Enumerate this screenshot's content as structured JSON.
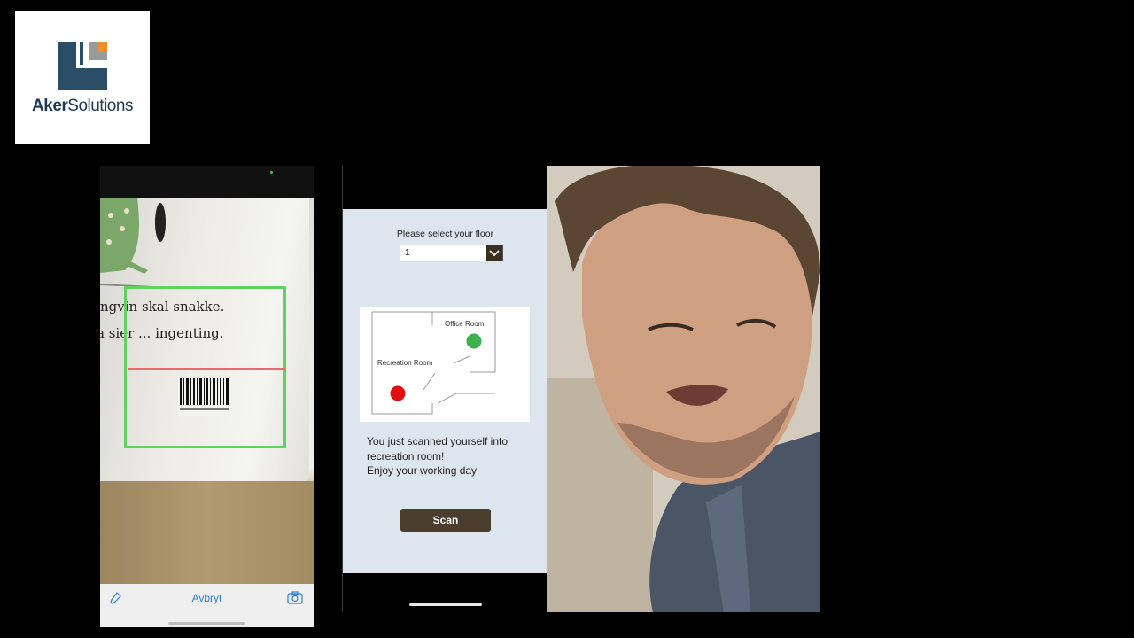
{
  "brand": {
    "name_bold": "Aker",
    "name_rest": "Solutions",
    "colors": {
      "navy": "#2a4e66",
      "orange": "#f28c28",
      "gray": "#9a9a9a"
    }
  },
  "scanner": {
    "book_line_1": "ngvin skal snakke.",
    "book_line_2": "a sier ... ingenting.",
    "cancel_label": "Avbryt",
    "frame_color": "#5fd25f",
    "laser_color": "#e86a6a",
    "icons": [
      "flashlight-icon",
      "camera-icon"
    ]
  },
  "floor_app": {
    "select_prompt": "Please select your floor",
    "floor_value": "1",
    "map": {
      "office_label": "Office Room",
      "recreation_label": "Recreation Room",
      "office_status_color": "#3cb04a",
      "recreation_status_color": "#e01010"
    },
    "message_line_1": "You just scanned yourself into",
    "message_line_2": "recreation room!",
    "message_line_3": "Enjoy your working day",
    "scan_button_label": "Scan"
  }
}
